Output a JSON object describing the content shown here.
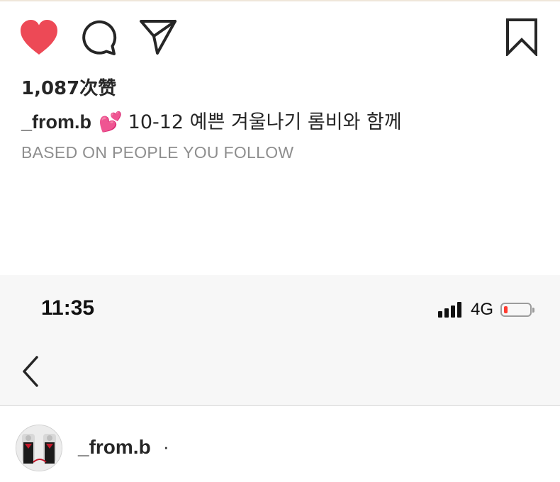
{
  "post": {
    "likes": "1,087次赞",
    "caption_user": "_from.b",
    "caption_emoji": "💕",
    "caption_text": "10-12 예쁜 겨울나기 롬비와 함께",
    "suggestion_label": "BASED ON PEOPLE YOU FOLLOW",
    "liked": true
  },
  "icons": {
    "like": "heart-icon",
    "comment": "comment-icon",
    "share": "paper-plane-icon",
    "save": "bookmark-icon",
    "back": "chevron-left-icon",
    "signal": "cellular-signal-icon",
    "battery": "battery-icon"
  },
  "status_bar": {
    "time": "11:35",
    "network": "4G",
    "battery_level": 0.15
  },
  "profile": {
    "username": "_from.b",
    "separator": "·"
  },
  "colors": {
    "like": "#ed4956",
    "battery_low": "#ff3b30",
    "muted_text": "#8e8e8e"
  }
}
